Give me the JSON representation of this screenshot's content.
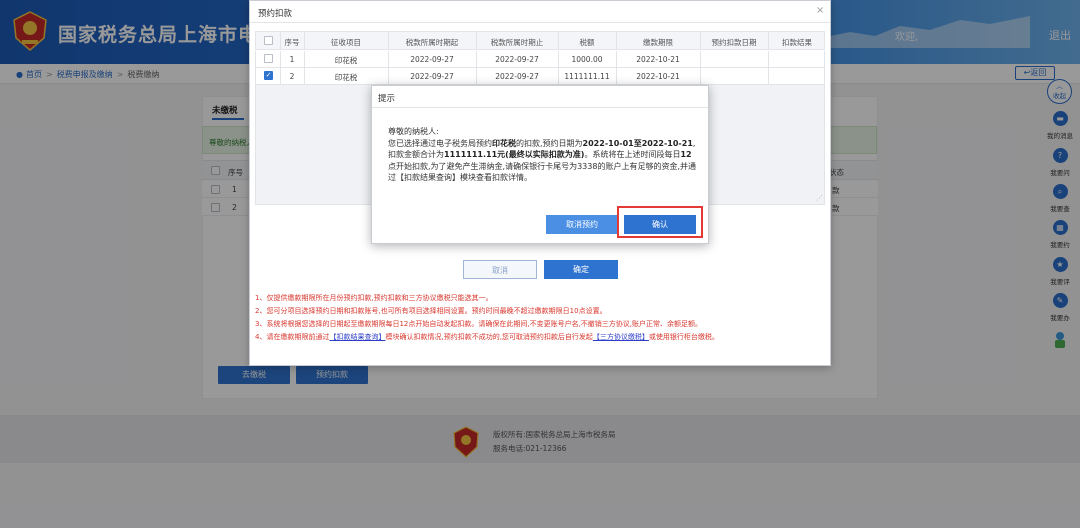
{
  "header": {
    "title": "国家税务总局上海市电子税务局",
    "welcome": "欢迎,",
    "logout": "退出"
  },
  "breadcrumb": {
    "home": "首页",
    "level2": "税费申报及缴纳",
    "current": "税费缴纳",
    "back": "返回"
  },
  "page": {
    "tab_unpaid": "未缴税",
    "notice": "尊敬的纳税人",
    "table_header": {
      "seq": "序号",
      "status": "状态"
    },
    "rows": [
      {
        "seq": "1",
        "status": "款"
      },
      {
        "seq": "2",
        "status": "款"
      }
    ],
    "pay_tax_btn": "去缴税",
    "book_debit_btn": "预约扣款"
  },
  "booking_dialog": {
    "title": "预约扣款",
    "close": "×",
    "columns": [
      "序号",
      "征收项目",
      "税款所属时期起",
      "税款所属时期止",
      "税额",
      "缴款期限",
      "预约扣款日期",
      "扣款结果"
    ],
    "rows": [
      {
        "checked": false,
        "seq": "1",
        "item": "印花税",
        "period_start": "2022-09-27",
        "period_end": "2022-09-27",
        "amount": "1000.00",
        "deadline": "2022-10-21",
        "booking_date": "",
        "result": ""
      },
      {
        "checked": true,
        "seq": "2",
        "item": "印花税",
        "period_start": "2022-09-27",
        "period_end": "2022-09-27",
        "amount": "1111111.11",
        "deadline": "2022-10-21",
        "booking_date": "",
        "result": ""
      }
    ],
    "cancel_btn": "取消",
    "confirm_btn": "确定",
    "notes": {
      "n1": "1、仅提供缴款期限所在月份预约扣款,预约扣款和三方协议缴税只能选其一。",
      "n2": "2、您可分项目选择预约日期和扣款账号,也可所有项目选择相同设置。预约时间最晚不超过缴款期限日10点设置。",
      "n3": "3、系统将根据您选择的日期起至缴款期限每日12点开始自动发起扣款。请确保在此期间,不变更账号户名,不撤销三方协议,账户正常、余额足额。",
      "n4_a": "4、请在缴款期限前通过",
      "n4_link1": "【扣款结果查询】",
      "n4_b": "模块确认扣款情况,预约扣款不成功的,您可取消预约扣款后自行发起",
      "n4_link2": "【三方协议缴税】",
      "n4_c": "或使用银行柜台缴税。"
    }
  },
  "prompt_dialog": {
    "title": "提示",
    "greeting": "尊敬的纳税人:",
    "p1": "您已选择通过电子税务局预约",
    "tax": "印花税",
    "p2": "的扣款,预约日期为",
    "date_range": "2022-10-01至2022-10-21",
    "p3": ",扣款金额合计为",
    "total": "1111111.11元(最终以实际扣款为准)",
    "p4": "。系统将在上述时间段每日",
    "time": "12",
    "p5": "点开始扣款,为了避免产生滞纳金,请确保银行卡尾号为3338的账户上有足够的资金,并通过【扣款结果查询】模块查看扣款详情。",
    "cancel_booking_btn": "取消预约",
    "confirm_btn": "确认"
  },
  "sidebar": {
    "collapse": "收起",
    "items": [
      {
        "label": "我的消息",
        "icon": "message-icon"
      },
      {
        "label": "我要问",
        "icon": "question-icon"
      },
      {
        "label": "我要查",
        "icon": "search-icon"
      },
      {
        "label": "我要约",
        "icon": "calendar-icon"
      },
      {
        "label": "我要评",
        "icon": "rate-icon"
      },
      {
        "label": "我要办",
        "icon": "edit-icon"
      }
    ]
  },
  "footer": {
    "copyright": "版权所有:国家税务总局上海市税务局",
    "phone": "服务电话:021-12366"
  },
  "colors": {
    "primary": "#2f73d1",
    "header": "#1d5bb8",
    "warning_text": "#d8382f",
    "highlight": "#e53935"
  }
}
